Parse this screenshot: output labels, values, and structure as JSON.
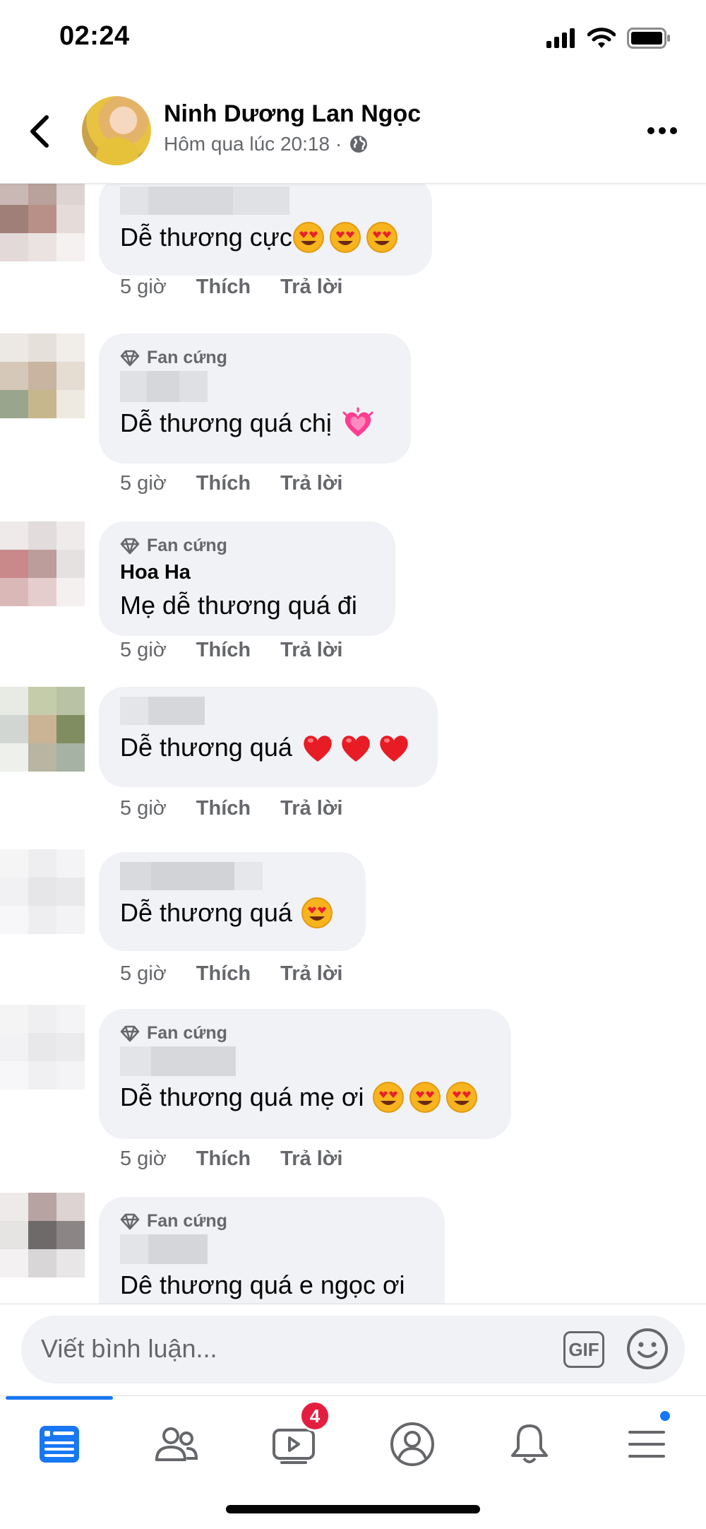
{
  "status_bar": {
    "time": "02:24"
  },
  "post": {
    "author": "Ninh Dương Lan Ngọc",
    "meta": "Hôm qua lúc 20:18 ·"
  },
  "comments": [
    {
      "name": "",
      "text": "Dễ thương cực",
      "emoji_count": 3,
      "emoji": "heart-eyes",
      "time": "5 giờ",
      "like": "Thích",
      "reply": "Trả lời"
    },
    {
      "badge": "Fan cứng",
      "name": "",
      "text": "Dễ thương quá chị",
      "emoji_count": 1,
      "emoji": "growing-heart",
      "time": "5 giờ",
      "like": "Thích",
      "reply": "Trả lời"
    },
    {
      "badge": "Fan cứng",
      "name": "Hoa Ha",
      "text": "Mẹ dễ thương quá đi",
      "emoji_count": 0,
      "time": "5 giờ",
      "like": "Thích",
      "reply": "Trả lời"
    },
    {
      "name": "",
      "text": "Dễ thương quá",
      "emoji_count": 3,
      "emoji": "red-heart",
      "time": "5 giờ",
      "like": "Thích",
      "reply": "Trả lời"
    },
    {
      "name": "",
      "text": "Dễ thương quá",
      "emoji_count": 1,
      "emoji": "heart-eyes",
      "time": "5 giờ",
      "like": "Thích",
      "reply": "Trả lời"
    },
    {
      "badge": "Fan cứng",
      "name": "",
      "text": "Dễ thương quá mẹ ơi",
      "emoji_count": 3,
      "emoji": "heart-eyes",
      "time": "5 giờ",
      "like": "Thích",
      "reply": "Trả lời"
    },
    {
      "badge": "Fan cứng",
      "name": "",
      "text": "Dê thương quá e ngọc ơi",
      "emoji_count": 0
    }
  ],
  "comment_input": {
    "placeholder": "Viết bình luận...",
    "gif_label": "GIF"
  },
  "tabs": [
    {
      "name": "news-feed",
      "active": true
    },
    {
      "name": "friends"
    },
    {
      "name": "watch",
      "badge": "4"
    },
    {
      "name": "profile"
    },
    {
      "name": "notifications"
    },
    {
      "name": "menu",
      "dot": true
    }
  ],
  "colors": {
    "accent": "#1877f2",
    "bubble": "#f0f2f5",
    "secondary_text": "#65676b",
    "badge_red": "#e41e3f"
  }
}
